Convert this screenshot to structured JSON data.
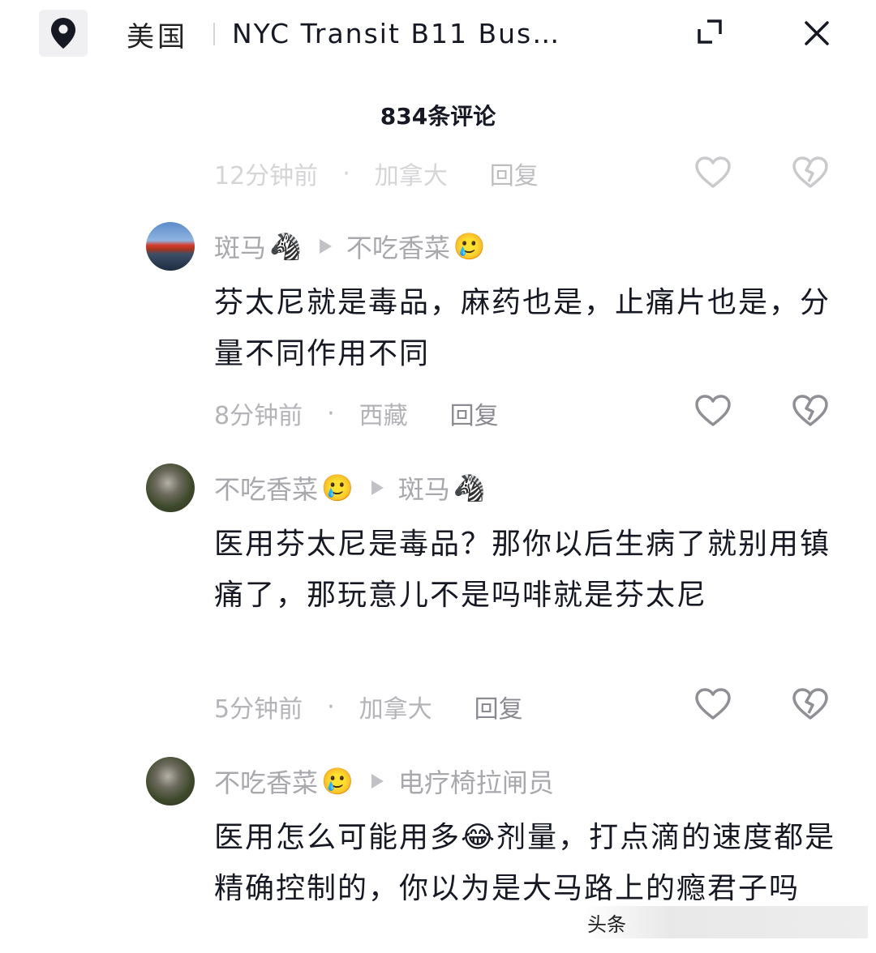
{
  "topbar": {
    "region": "美国",
    "title": "NYC Transit B11 Bus…",
    "icons": {
      "location": "location-pin-icon",
      "expand": "expand-icon",
      "close": "close-icon"
    }
  },
  "comments_header": {
    "count_label": "834条评论"
  },
  "comments": [
    {
      "time": "12分钟前",
      "location": "加拿大",
      "reply": "回复"
    },
    {
      "author": "斑马",
      "author_emoji": "🦓",
      "reply_to": "不吃香菜",
      "reply_to_emoji": "🥲",
      "text": "芬太尼就是毒品，麻药也是，止痛片也是，分量不同作用不同",
      "time": "8分钟前",
      "location": "西藏",
      "reply": "回复"
    },
    {
      "author": "不吃香菜",
      "author_emoji": "🥲",
      "reply_to": "斑马",
      "reply_to_emoji": "🦓",
      "text": "医用芬太尼是毒品？那你以后生病了就别用镇痛了，那玩意儿不是吗啡就是芬太尼",
      "time": "5分钟前",
      "location": "加拿大",
      "reply": "回复"
    },
    {
      "author": "不吃香菜",
      "author_emoji": "🥲",
      "reply_to": "电疗椅拉闸员",
      "text_before": "医用怎么可能用多",
      "text_emoji": "😂",
      "text_after": "剂量，打点滴的速度都是精确控制的，你以为是大马路上的瘾君子吗"
    }
  ],
  "watermark": {
    "text": "头条"
  }
}
